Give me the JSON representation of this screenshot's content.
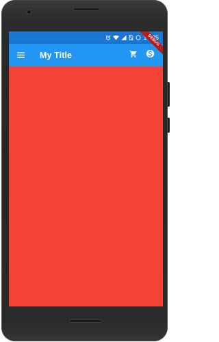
{
  "status_bar": {
    "time": "10:25",
    "icons": [
      "alarm-icon",
      "wifi-icon",
      "signal-icon",
      "no-sim-icon",
      "battery-icon"
    ]
  },
  "app_bar": {
    "title": "My Title",
    "background": "#2196f3",
    "menu_icon": "menu-icon",
    "actions": [
      "shopping-cart-icon",
      "monetization-icon"
    ]
  },
  "debug_banner": {
    "label": "DEBUG"
  },
  "body": {
    "background": "#f44336"
  }
}
